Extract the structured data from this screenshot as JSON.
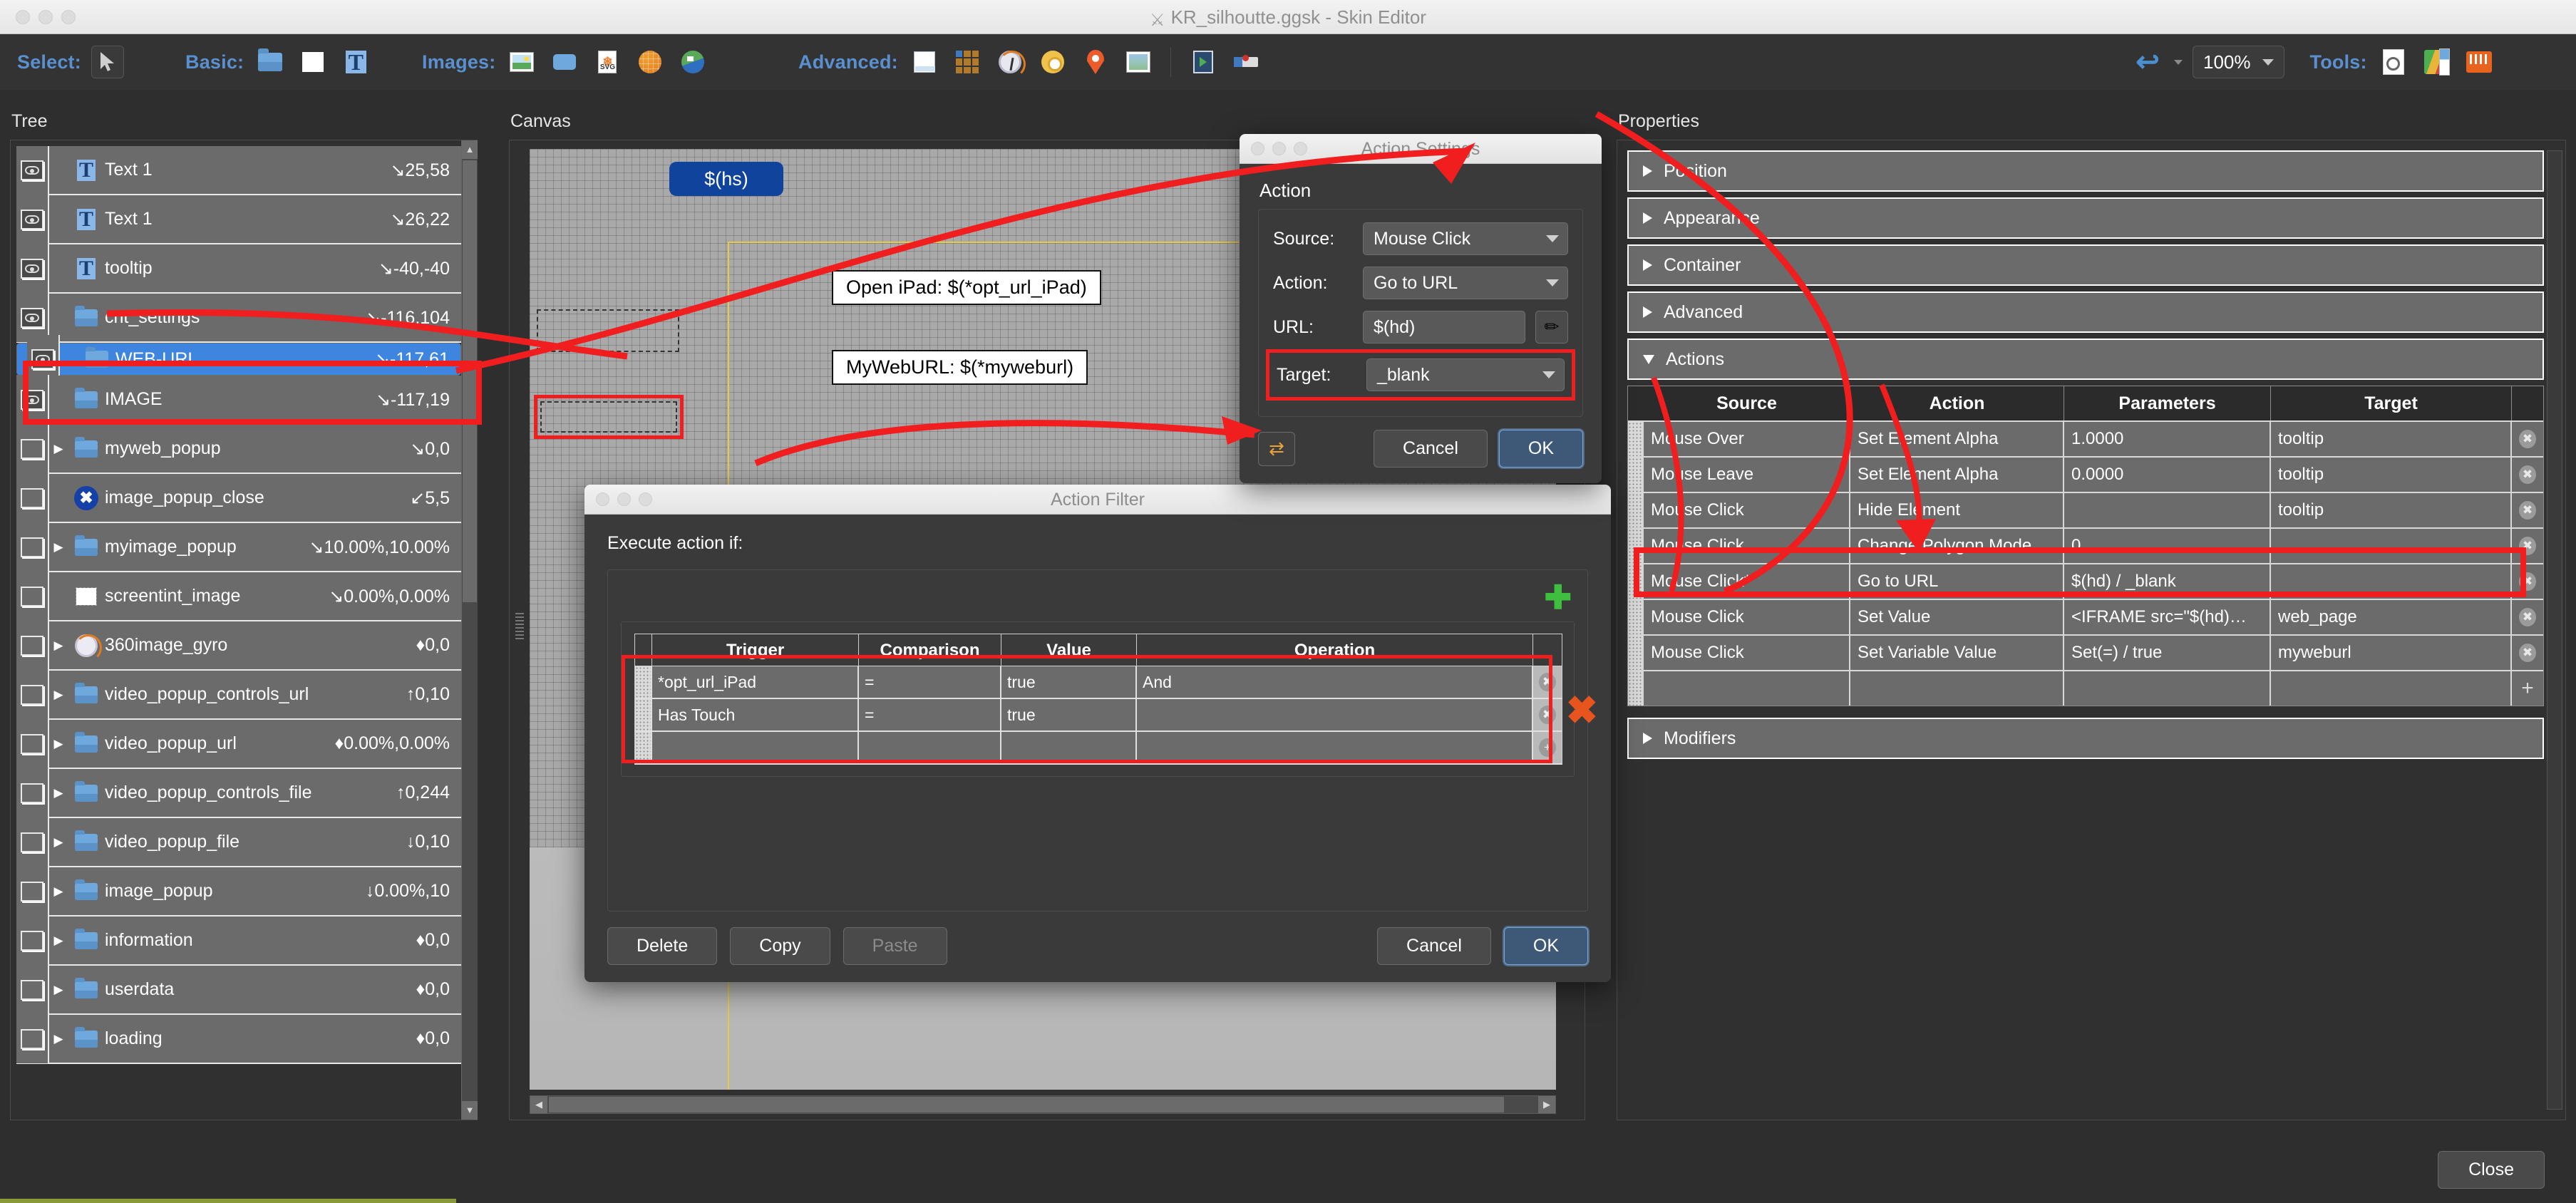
{
  "window": {
    "title": "KR_silhoutte.ggsk - Skin Editor",
    "icon": "app-icon"
  },
  "toolbar": {
    "select_label": "Select:",
    "basic_label": "Basic:",
    "images_label": "Images:",
    "advanced_label": "Advanced:",
    "tools_label": "Tools:",
    "zoom_value": "100%",
    "icons": {
      "cursor": "cursor-icon",
      "folder": "folder-icon",
      "rectangle": "rectangle-icon",
      "text": "text-icon",
      "image": "image-icon",
      "hotspot": "hotspot-icon",
      "svg": "svg-icon",
      "globe_360": "360-globe-icon",
      "map_globe": "map-globe-icon",
      "panel": "panel-icon",
      "grid": "grid-icon",
      "compass": "compass-icon",
      "gyro": "gyro-icon",
      "pin": "map-pin-icon",
      "map": "map-icon",
      "video": "video-icon",
      "progress": "progressbar-icon",
      "undo": "undo-icon",
      "inspector": "inspector-icon",
      "palette": "palette-icon",
      "toolbox": "toolbox-icon"
    }
  },
  "panels": {
    "tree_label": "Tree",
    "canvas_label": "Canvas",
    "properties_label": "Properties"
  },
  "tree": {
    "items": [
      {
        "name": "Text 1",
        "coord": "25,58",
        "arrow": "↘",
        "icon": "text-icon",
        "visible": true,
        "expandable": false,
        "selected": false
      },
      {
        "name": "Text 1",
        "coord": "26,22",
        "arrow": "↘",
        "icon": "text-icon",
        "visible": true,
        "expandable": false,
        "selected": false
      },
      {
        "name": "tooltip",
        "coord": "-40,-40",
        "arrow": "↘",
        "icon": "text-icon",
        "visible": true,
        "expandable": false,
        "selected": false
      },
      {
        "name": "cnt_settings",
        "coord": "-116,104",
        "arrow": "↘",
        "icon": "folder-icon",
        "visible": true,
        "expandable": false,
        "selected": false
      },
      {
        "name": "WEB-URL",
        "coord": "-117,61",
        "arrow": "↘",
        "icon": "folder-icon",
        "visible": true,
        "expandable": false,
        "selected": true
      },
      {
        "name": "IMAGE",
        "coord": "-117,19",
        "arrow": "↘",
        "icon": "folder-icon",
        "visible": true,
        "expandable": false,
        "selected": false
      },
      {
        "name": "myweb_popup",
        "coord": "0,0",
        "arrow": "↘",
        "icon": "folder-icon",
        "visible": false,
        "expandable": true,
        "selected": false
      },
      {
        "name": "image_popup_close",
        "coord": "5,5",
        "arrow": "↙",
        "icon": "close-circle-icon",
        "visible": false,
        "expandable": false,
        "selected": false
      },
      {
        "name": "myimage_popup",
        "coord": "10.00%,10.00%",
        "arrow": "↘",
        "icon": "folder-icon",
        "visible": false,
        "expandable": true,
        "selected": false
      },
      {
        "name": "screentint_image",
        "coord": "0.00%,0.00%",
        "arrow": "↘",
        "icon": "rectangle-icon",
        "visible": false,
        "expandable": false,
        "selected": false
      },
      {
        "name": "360image_gyro",
        "coord": "0,0",
        "arrow": "♦",
        "icon": "compass-icon",
        "visible": false,
        "expandable": true,
        "selected": false
      },
      {
        "name": "video_popup_controls_url",
        "coord": "0,10",
        "arrow": "↑",
        "icon": "folder-icon",
        "visible": false,
        "expandable": true,
        "selected": false
      },
      {
        "name": "video_popup_url",
        "coord": "0.00%,0.00%",
        "arrow": "♦",
        "icon": "folder-icon",
        "visible": false,
        "expandable": true,
        "selected": false
      },
      {
        "name": "video_popup_controls_file",
        "coord": "0,244",
        "arrow": "↑",
        "icon": "folder-icon",
        "visible": false,
        "expandable": true,
        "selected": false
      },
      {
        "name": "video_popup_file",
        "coord": "0,10",
        "arrow": "↓",
        "icon": "folder-icon",
        "visible": false,
        "expandable": true,
        "selected": false
      },
      {
        "name": "image_popup",
        "coord": "0.00%,10",
        "arrow": "↓",
        "icon": "folder-icon",
        "visible": false,
        "expandable": true,
        "selected": false
      },
      {
        "name": "information",
        "coord": "0,0",
        "arrow": "♦",
        "icon": "folder-icon",
        "visible": false,
        "expandable": true,
        "selected": false
      },
      {
        "name": "userdata",
        "coord": "0,0",
        "arrow": "♦",
        "icon": "folder-icon",
        "visible": false,
        "expandable": true,
        "selected": false
      },
      {
        "name": "loading",
        "coord": "0,0",
        "arrow": "♦",
        "icon": "folder-icon",
        "visible": false,
        "expandable": true,
        "selected": false
      }
    ]
  },
  "canvas": {
    "hotspot_badge": "$(hs)",
    "label_open_ipad": "Open iPad: $(*opt_url_iPad)",
    "label_myweburl": "MyWebURL: $(*myweburl)"
  },
  "properties": {
    "sections": [
      {
        "label": "Position",
        "expanded": false
      },
      {
        "label": "Appearance",
        "expanded": false
      },
      {
        "label": "Container",
        "expanded": false
      },
      {
        "label": "Advanced",
        "expanded": false
      },
      {
        "label": "Actions",
        "expanded": true
      },
      {
        "label": "Modifiers",
        "expanded": false
      }
    ],
    "actions_table": {
      "headers": [
        "Source",
        "Action",
        "Parameters",
        "Target"
      ],
      "rows": [
        {
          "source": "Mouse Over",
          "action": "Set Element Alpha",
          "parameters": "1.0000",
          "target": "tooltip",
          "highlighted": false
        },
        {
          "source": "Mouse Leave",
          "action": "Set Element Alpha",
          "parameters": "0.0000",
          "target": "tooltip",
          "highlighted": false
        },
        {
          "source": "Mouse Click",
          "action": "Hide Element",
          "parameters": "",
          "target": "tooltip",
          "highlighted": false
        },
        {
          "source": "Mouse Click",
          "action": "Change Polygon Mode",
          "parameters": "0",
          "target": "",
          "highlighted": false
        },
        {
          "source": "Mouse Click*",
          "action": "Go to URL",
          "parameters": "$(hd) / _blank",
          "target": "",
          "highlighted": true
        },
        {
          "source": "Mouse Click",
          "action": "Set Value",
          "parameters": "<IFRAME src=\"$(hd)…",
          "target": "web_page",
          "highlighted": false
        },
        {
          "source": "Mouse Click",
          "action": "Set Variable Value",
          "parameters": "Set(=) / true",
          "target": "myweburl",
          "highlighted": false
        }
      ]
    }
  },
  "action_settings_dialog": {
    "title": "Action Settings",
    "group_label": "Action",
    "fields": {
      "source_label": "Source:",
      "source_value": "Mouse Click",
      "action_label": "Action:",
      "action_value": "Go to URL",
      "url_label": "URL:",
      "url_value": "$(hd)",
      "target_label": "Target:",
      "target_value": "_blank"
    },
    "buttons": {
      "cancel": "Cancel",
      "ok": "OK",
      "swap": "swap-action-icon",
      "edit": "pencil-icon"
    }
  },
  "action_filter_dialog": {
    "title": "Action Filter",
    "prompt": "Execute action if:",
    "table": {
      "headers": [
        "Trigger",
        "Comparison",
        "Value",
        "Operation"
      ],
      "rows": [
        {
          "trigger": "*opt_url_iPad",
          "comparison": "=",
          "value": "true",
          "operation": "And"
        },
        {
          "trigger": "Has Touch",
          "comparison": "=",
          "value": "true",
          "operation": ""
        }
      ]
    },
    "buttons": {
      "delete": "Delete",
      "copy": "Copy",
      "paste": "Paste",
      "cancel": "Cancel",
      "ok": "OK",
      "add": "add-icon",
      "remove": "remove-icon"
    }
  },
  "footer": {
    "close": "Close"
  },
  "colors": {
    "accent_blue": "#5a8fd0",
    "selection_blue": "#3e85e0",
    "annotation_red": "#f01e1e",
    "panel_bg": "#303030",
    "toolbar_bg": "#333333"
  }
}
